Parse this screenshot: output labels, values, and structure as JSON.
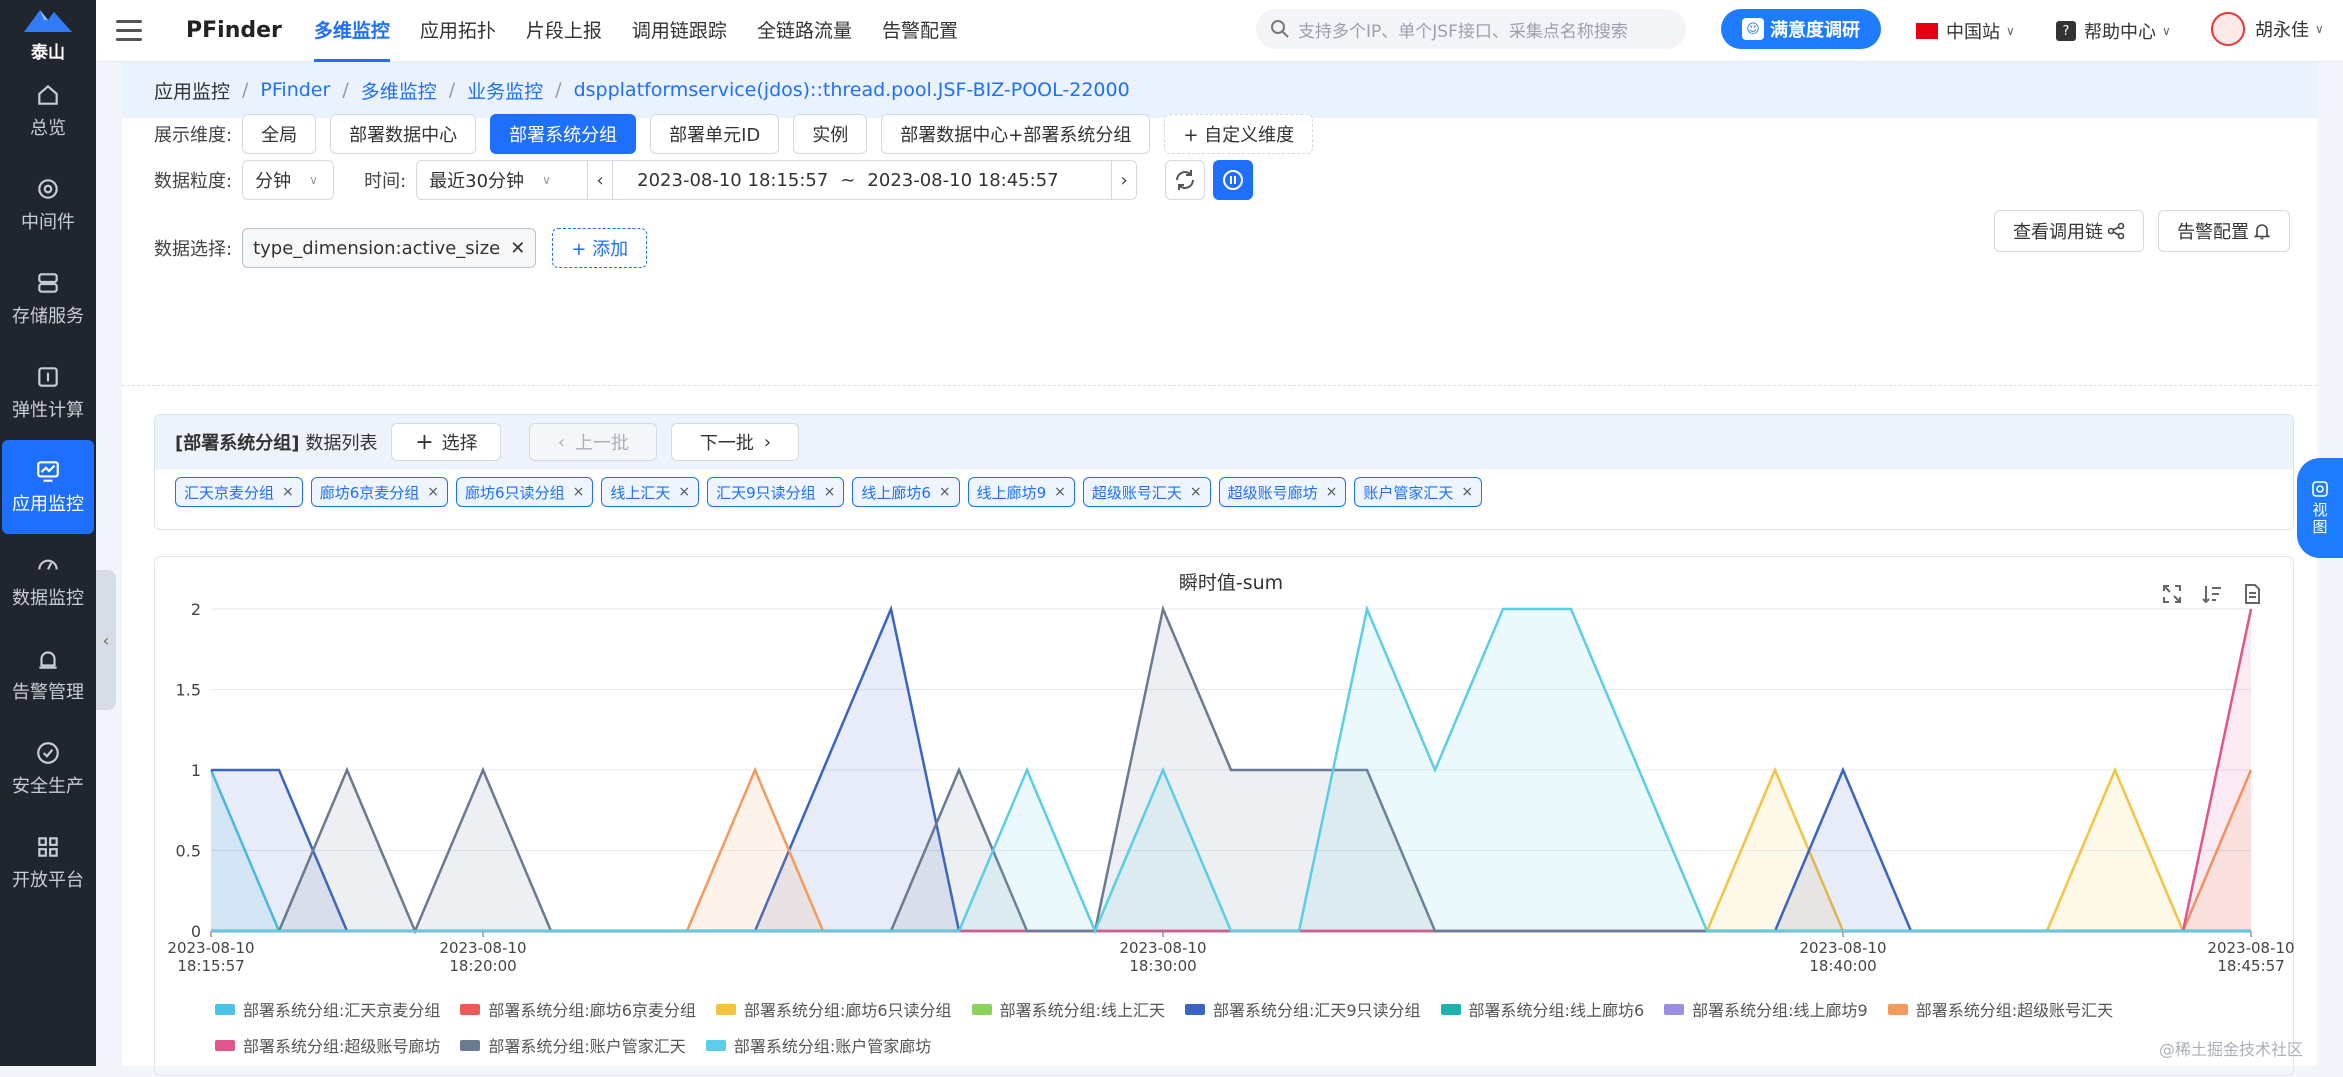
{
  "nav": {
    "logo_text": "泰山",
    "items": [
      {
        "label": "总览",
        "icon": "home-icon"
      },
      {
        "label": "中间件",
        "icon": "middleware-icon"
      },
      {
        "label": "存储服务",
        "icon": "storage-icon"
      },
      {
        "label": "弹性计算",
        "icon": "compute-icon"
      },
      {
        "label": "应用监控",
        "icon": "monitor-icon",
        "active": true
      },
      {
        "label": "数据监控",
        "icon": "gauge-icon"
      },
      {
        "label": "告警管理",
        "icon": "alarm-icon"
      },
      {
        "label": "安全生产",
        "icon": "shield-check-icon"
      },
      {
        "label": "开放平台",
        "icon": "grid-icon"
      }
    ]
  },
  "topbar": {
    "brand": "PFinder",
    "tabs": [
      "多维监控",
      "应用拓扑",
      "片段上报",
      "调用链跟踪",
      "全链路流量",
      "告警配置"
    ],
    "search_placeholder": "支持多个IP、单个JSF接口、采集点名称搜索",
    "survey_label": "满意度调研",
    "site_label": "中国站",
    "help_label": "帮助中心",
    "user_name": "胡永佳"
  },
  "breadcrumb": [
    "应用监控",
    "PFinder",
    "多维监控",
    "业务监控",
    "dspplatformservice(jdos)::thread.pool.JSF-BIZ-POOL-22000"
  ],
  "filters": {
    "dimension_label": "展示维度:",
    "dimensions": [
      "全局",
      "部署数据中心",
      "部署系统分组",
      "部署单元ID",
      "实例",
      "部署数据中心+部署系统分组"
    ],
    "dimension_active": "部署系统分组",
    "custom_dimension": "+ 自定义维度",
    "granularity_label": "数据粒度:",
    "granularity_value": "分钟",
    "time_label": "时间:",
    "time_preset": "最近30分钟",
    "time_start": "2023-08-10 18:15:57",
    "time_sep": "~",
    "time_end": "2023-08-10 18:45:57",
    "data_label": "数据选择:",
    "data_tag": "type_dimension:active_size",
    "add_label": "+ 添加",
    "trace_btn": "查看调用链",
    "alarm_btn": "告警配置"
  },
  "series_panel": {
    "title_bold": "[部署系统分组]",
    "title_rest": "数据列表",
    "select_btn": "选择",
    "prev_btn": "上一批",
    "next_btn": "下一批",
    "tags": [
      "汇天京麦分组",
      "廊坊6京麦分组",
      "廊坊6只读分组",
      "线上汇天",
      "汇天9只读分组",
      "线上廊坊6",
      "线上廊坊9",
      "超级账号汇天",
      "超级账号廊坊",
      "账户管家汇天"
    ]
  },
  "chart_data": {
    "type": "area",
    "title": "瞬时值-sum",
    "ylim": [
      0,
      2
    ],
    "yticks": [
      "0",
      "0.5",
      "1",
      "1.5",
      "2"
    ],
    "xticks": [
      {
        "date": "2023-08-10",
        "time": "18:15:57"
      },
      {
        "date": "2023-08-10",
        "time": "18:20:00"
      },
      {
        "date": "2023-08-10",
        "time": "18:30:00"
      },
      {
        "date": "2023-08-10",
        "time": "18:40:00"
      },
      {
        "date": "2023-08-10",
        "time": "18:45:57"
      }
    ],
    "x_minutes": [
      0,
      1,
      2,
      3,
      4,
      5,
      6,
      7,
      8,
      9,
      10,
      11,
      12,
      13,
      14,
      15,
      16,
      17,
      18,
      19,
      20,
      21,
      22,
      23,
      24,
      25,
      26,
      27,
      28,
      29,
      30
    ],
    "grid": true,
    "legend_position": "bottom",
    "series": [
      {
        "name": "部署系统分组:汇天京麦分组",
        "color": "#4cc3e6",
        "values": [
          1,
          0,
          0,
          0,
          0,
          0,
          0,
          0,
          0,
          0,
          0,
          0,
          0,
          0,
          0,
          0,
          0,
          0,
          0,
          0,
          0,
          0,
          0,
          0,
          0,
          0,
          0,
          0,
          0,
          0,
          0
        ]
      },
      {
        "name": "部署系统分组:廊坊6京麦分组",
        "color": "#ee5a5a",
        "values": [
          0,
          0,
          0,
          0,
          0,
          0,
          0,
          0,
          0,
          0,
          0,
          0,
          0,
          0,
          0,
          0,
          0,
          0,
          0,
          0,
          0,
          0,
          0,
          0,
          0,
          0,
          0,
          0,
          0,
          0,
          0
        ]
      },
      {
        "name": "部署系统分组:廊坊6只读分组",
        "color": "#f5c342",
        "values": [
          0,
          0,
          0,
          0,
          0,
          0,
          0,
          0,
          0,
          0,
          0,
          0,
          0,
          0,
          0,
          0,
          0,
          0,
          0,
          0,
          0,
          0,
          0,
          1,
          0,
          0,
          0,
          0,
          1,
          0,
          0
        ]
      },
      {
        "name": "部署系统分组:线上汇天",
        "color": "#8bd15a",
        "values": [
          0,
          0,
          0,
          0,
          0,
          0,
          0,
          0,
          0,
          0,
          0,
          0,
          0,
          0,
          0,
          0,
          0,
          0,
          0,
          0,
          0,
          0,
          0,
          0,
          0,
          0,
          0,
          0,
          0,
          0,
          0
        ]
      },
      {
        "name": "部署系统分组:汇天9只读分组",
        "color": "#3a64c2",
        "values": [
          1,
          1,
          0,
          0,
          0,
          0,
          0,
          0,
          0,
          1,
          2,
          0,
          0,
          0,
          0,
          0,
          0,
          0,
          0,
          0,
          0,
          0,
          0,
          0,
          1,
          0,
          0,
          0,
          0,
          0,
          0
        ]
      },
      {
        "name": "部署系统分组:线上廊坊6",
        "color": "#20b2aa",
        "values": [
          0,
          0,
          0,
          0,
          0,
          0,
          0,
          0,
          0,
          0,
          0,
          0,
          0,
          0,
          0,
          0,
          0,
          0,
          0,
          0,
          0,
          0,
          0,
          0,
          0,
          0,
          0,
          0,
          0,
          0,
          0
        ]
      },
      {
        "name": "部署系统分组:线上廊坊9",
        "color": "#9b8ee0",
        "values": [
          0,
          0,
          0,
          0,
          0,
          0,
          0,
          0,
          0,
          0,
          0,
          0,
          0,
          0,
          0,
          0,
          0,
          0,
          0,
          0,
          0,
          0,
          0,
          0,
          0,
          0,
          0,
          0,
          0,
          0,
          0
        ]
      },
      {
        "name": "部署系统分组:超级账号汇天",
        "color": "#f59a5a",
        "values": [
          0,
          0,
          0,
          0,
          0,
          0,
          0,
          0,
          1,
          0,
          0,
          0,
          0,
          0,
          0,
          0,
          0,
          0,
          0,
          0,
          0,
          0,
          0,
          0,
          0,
          0,
          0,
          0,
          0,
          0,
          1
        ]
      },
      {
        "name": "部署系统分组:超级账号廊坊",
        "color": "#e0558c",
        "values": [
          0,
          0,
          0,
          0,
          0,
          0,
          0,
          0,
          0,
          0,
          0,
          0,
          0,
          0,
          0,
          0,
          0,
          0,
          0,
          0,
          0,
          0,
          0,
          0,
          0,
          0,
          0,
          0,
          0,
          0,
          2
        ]
      },
      {
        "name": "部署系统分组:账户管家汇天",
        "color": "#6b7a90",
        "values": [
          0,
          0,
          1,
          0,
          1,
          0,
          0,
          0,
          0,
          0,
          0,
          1,
          0,
          0,
          2,
          1,
          1,
          1,
          0,
          0,
          0,
          0,
          0,
          0,
          0,
          0,
          0,
          0,
          0,
          0,
          0
        ]
      },
      {
        "name": "部署系统分组:账户管家廊坊",
        "color": "#5ccde6",
        "values": [
          0,
          0,
          0,
          0,
          0,
          0,
          0,
          0,
          0,
          0,
          0,
          0,
          1,
          0,
          1,
          0,
          0,
          2,
          1,
          2,
          2,
          1,
          0,
          0,
          0,
          0,
          0,
          0,
          0,
          0,
          0
        ]
      }
    ]
  },
  "view_tab": "视图",
  "watermark": "@稀土掘金技术社区"
}
